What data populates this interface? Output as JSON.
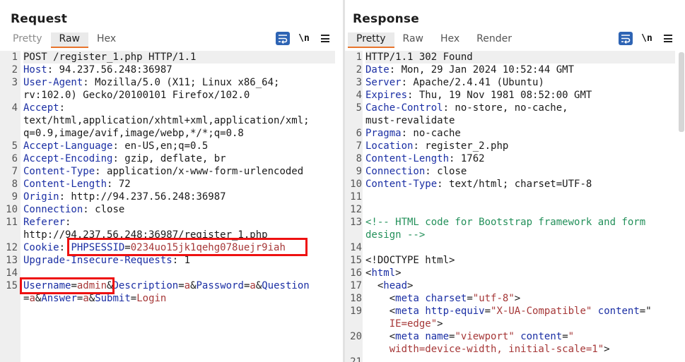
{
  "request": {
    "title": "Request",
    "tabs": [
      "Pretty",
      "Raw",
      "Hex"
    ],
    "active_tab": "Raw",
    "tools": {
      "wrap_icon": "wrap-lines-icon",
      "newline_label": "\\n",
      "menu_icon": "hamburger-menu-icon"
    },
    "lines": [
      {
        "n": "1",
        "segs": [
          [
            "v",
            "POST /register_1.php HTTP/1.1"
          ]
        ]
      },
      {
        "n": "2",
        "segs": [
          [
            "k",
            "Host"
          ],
          [
            "v",
            ": 94.237.56.248:36987"
          ]
        ]
      },
      {
        "n": "3",
        "segs": [
          [
            "k",
            "User-Agent"
          ],
          [
            "v",
            ": Mozilla/5.0 (X11; Linux x86_64;"
          ]
        ]
      },
      {
        "n": "",
        "segs": [
          [
            "v",
            "rv:102.0) Gecko/20100101 Firefox/102.0"
          ]
        ]
      },
      {
        "n": "4",
        "segs": [
          [
            "k",
            "Accept"
          ],
          [
            "v",
            ":"
          ]
        ]
      },
      {
        "n": "",
        "segs": [
          [
            "v",
            "text/html,application/xhtml+xml,application/xml;"
          ]
        ]
      },
      {
        "n": "",
        "segs": [
          [
            "v",
            "q=0.9,image/avif,image/webp,*/*;q=0.8"
          ]
        ]
      },
      {
        "n": "5",
        "segs": [
          [
            "k",
            "Accept-Language"
          ],
          [
            "v",
            ": en-US,en;q=0.5"
          ]
        ]
      },
      {
        "n": "6",
        "segs": [
          [
            "k",
            "Accept-Encoding"
          ],
          [
            "v",
            ": gzip, deflate, br"
          ]
        ]
      },
      {
        "n": "7",
        "segs": [
          [
            "k",
            "Content-Type"
          ],
          [
            "v",
            ": application/x-www-form-urlencoded"
          ]
        ]
      },
      {
        "n": "8",
        "segs": [
          [
            "k",
            "Content-Length"
          ],
          [
            "v",
            ": 72"
          ]
        ]
      },
      {
        "n": "9",
        "segs": [
          [
            "k",
            "Origin"
          ],
          [
            "v",
            ": http://94.237.56.248:36987"
          ]
        ]
      },
      {
        "n": "10",
        "segs": [
          [
            "k",
            "Connection"
          ],
          [
            "v",
            ": close"
          ]
        ]
      },
      {
        "n": "11",
        "segs": [
          [
            "k",
            "Referer"
          ],
          [
            "v",
            ":"
          ]
        ]
      },
      {
        "n": "",
        "segs": [
          [
            "v",
            "http://94.237.56.248:36987/register_1.php"
          ]
        ]
      },
      {
        "n": "12",
        "segs": [
          [
            "k",
            "Cookie"
          ],
          [
            "v",
            ": "
          ],
          [
            "pk",
            "PHPSESSID"
          ],
          [
            "v",
            "="
          ],
          [
            "pv",
            "0234uo15jk1qehg078uejr9iah"
          ]
        ]
      },
      {
        "n": "13",
        "segs": [
          [
            "k",
            "Upgrade-Insecure-Requests"
          ],
          [
            "v",
            ": 1"
          ]
        ]
      },
      {
        "n": "14",
        "segs": []
      },
      {
        "n": "15",
        "segs": [
          [
            "pk",
            "Username"
          ],
          [
            "v",
            "="
          ],
          [
            "pv",
            "admin"
          ],
          [
            "v",
            "&"
          ],
          [
            "pk",
            "Description"
          ],
          [
            "v",
            "="
          ],
          [
            "pv",
            "a"
          ],
          [
            "v",
            "&"
          ],
          [
            "pk",
            "Password"
          ],
          [
            "v",
            "="
          ],
          [
            "pv",
            "a"
          ],
          [
            "v",
            "&"
          ],
          [
            "pk",
            "Question"
          ]
        ]
      },
      {
        "n": "",
        "segs": [
          [
            "v",
            "="
          ],
          [
            "pv",
            "a"
          ],
          [
            "v",
            "&"
          ],
          [
            "pk",
            "Answer"
          ],
          [
            "v",
            "="
          ],
          [
            "pv",
            "a"
          ],
          [
            "v",
            "&"
          ],
          [
            "pk",
            "Submit"
          ],
          [
            "v",
            "="
          ],
          [
            "pv",
            "Login"
          ]
        ]
      }
    ]
  },
  "response": {
    "title": "Response",
    "tabs": [
      "Pretty",
      "Raw",
      "Hex",
      "Render"
    ],
    "active_tab": "Pretty",
    "tools": {
      "wrap_icon": "wrap-lines-icon",
      "newline_label": "\\n",
      "menu_icon": "hamburger-menu-icon"
    },
    "lines": [
      {
        "n": "1",
        "segs": [
          [
            "v",
            "HTTP/1.1 302 Found"
          ]
        ]
      },
      {
        "n": "2",
        "segs": [
          [
            "k",
            "Date"
          ],
          [
            "v",
            ": Mon, 29 Jan 2024 10:52:44 GMT"
          ]
        ]
      },
      {
        "n": "3",
        "segs": [
          [
            "k",
            "Server"
          ],
          [
            "v",
            ": Apache/2.4.41 (Ubuntu)"
          ]
        ]
      },
      {
        "n": "4",
        "segs": [
          [
            "k",
            "Expires"
          ],
          [
            "v",
            ": Thu, 19 Nov 1981 08:52:00 GMT"
          ]
        ]
      },
      {
        "n": "5",
        "segs": [
          [
            "k",
            "Cache-Control"
          ],
          [
            "v",
            ": no-store, no-cache,"
          ]
        ]
      },
      {
        "n": "",
        "segs": [
          [
            "v",
            "must-revalidate"
          ]
        ]
      },
      {
        "n": "6",
        "segs": [
          [
            "k",
            "Pragma"
          ],
          [
            "v",
            ": no-cache"
          ]
        ]
      },
      {
        "n": "7",
        "segs": [
          [
            "k",
            "Location"
          ],
          [
            "v",
            ": register_2.php"
          ]
        ]
      },
      {
        "n": "8",
        "segs": [
          [
            "k",
            "Content-Length"
          ],
          [
            "v",
            ": 1762"
          ]
        ]
      },
      {
        "n": "9",
        "segs": [
          [
            "k",
            "Connection"
          ],
          [
            "v",
            ": close"
          ]
        ]
      },
      {
        "n": "10",
        "segs": [
          [
            "k",
            "Content-Type"
          ],
          [
            "v",
            ": text/html; charset=UTF-8"
          ]
        ]
      },
      {
        "n": "11",
        "segs": []
      },
      {
        "n": "12",
        "segs": []
      },
      {
        "n": "13",
        "segs": [
          [
            "cm",
            "<!-- HTML code for Bootstrap framework and form"
          ]
        ]
      },
      {
        "n": "",
        "segs": [
          [
            "cm",
            "design -->"
          ]
        ]
      },
      {
        "n": "14",
        "segs": []
      },
      {
        "n": "15",
        "segs": [
          [
            "v",
            "<!DOCTYPE html>"
          ]
        ]
      },
      {
        "n": "16",
        "segs": [
          [
            "v",
            "<"
          ],
          [
            "tg",
            "html"
          ],
          [
            "v",
            ">"
          ]
        ]
      },
      {
        "n": "17",
        "segs": [
          [
            "v",
            "  <"
          ],
          [
            "tg",
            "head"
          ],
          [
            "v",
            ">"
          ]
        ]
      },
      {
        "n": "18",
        "segs": [
          [
            "v",
            "    <"
          ],
          [
            "tg",
            "meta"
          ],
          [
            "v",
            " "
          ],
          [
            "at",
            "charset"
          ],
          [
            "v",
            "="
          ],
          [
            "av",
            "\"utf-8\""
          ],
          [
            "v",
            ">"
          ]
        ]
      },
      {
        "n": "19",
        "segs": [
          [
            "v",
            "    <"
          ],
          [
            "tg",
            "meta"
          ],
          [
            "v",
            " "
          ],
          [
            "at",
            "http-equiv"
          ],
          [
            "v",
            "="
          ],
          [
            "av",
            "\"X-UA-Compatible\""
          ],
          [
            "v",
            " "
          ],
          [
            "at",
            "content"
          ],
          [
            "v",
            "=\""
          ]
        ]
      },
      {
        "n": "",
        "segs": [
          [
            "av",
            "    IE=edge"
          ],
          [
            "av",
            "\""
          ],
          [
            "v",
            ">"
          ]
        ]
      },
      {
        "n": "20",
        "segs": [
          [
            "v",
            "    <"
          ],
          [
            "tg",
            "meta"
          ],
          [
            "v",
            " "
          ],
          [
            "at",
            "name"
          ],
          [
            "v",
            "="
          ],
          [
            "av",
            "\"viewport\""
          ],
          [
            "v",
            " "
          ],
          [
            "at",
            "content"
          ],
          [
            "v",
            "="
          ],
          [
            "av",
            "\""
          ]
        ]
      },
      {
        "n": "",
        "segs": [
          [
            "av",
            "    width=device-width, initial-scale=1\""
          ],
          [
            "v",
            ">"
          ]
        ]
      },
      {
        "n": "21",
        "segs": []
      }
    ]
  },
  "layout_buttons": [
    "split-horizontal-icon",
    "split-vertical-icon",
    "single-pane-icon"
  ]
}
